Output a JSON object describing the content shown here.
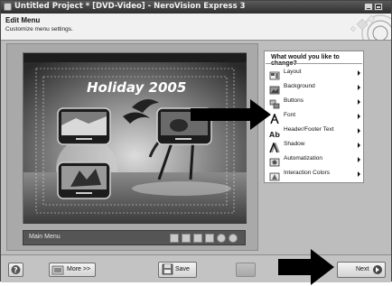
{
  "window": {
    "title": "Untitled Project * [DVD-Video] - NeroVision Express 3",
    "app_icon": "nerovision-app-icon",
    "controls": [
      "minimize-icon",
      "maximize-icon"
    ]
  },
  "header": {
    "title": "Edit Menu",
    "subtitle": "Customize menu settings."
  },
  "preview": {
    "menu_title": "Holiday 2005",
    "thumbnails": 3,
    "menu_bar_label": "Main Menu",
    "menu_bar_icons": [
      "page-icon",
      "page-icon",
      "page-icon",
      "page-icon",
      "circle-check-icon",
      "circle-check-icon"
    ]
  },
  "side_panel": {
    "question": "What would you like to change?",
    "options": [
      {
        "label": "Layout",
        "icon": "layout-icon"
      },
      {
        "label": "Background",
        "icon": "background-icon"
      },
      {
        "label": "Buttons",
        "icon": "buttons-icon"
      },
      {
        "label": "Font",
        "icon": "font-icon"
      },
      {
        "label": "Header/Footer Text",
        "icon": "header-footer-icon"
      },
      {
        "label": "Shadow",
        "icon": "shadow-icon"
      },
      {
        "label": "Automatization",
        "icon": "automatization-icon"
      },
      {
        "label": "Interaction Colors",
        "icon": "interaction-colors-icon"
      }
    ]
  },
  "bottom": {
    "help_icon": "help-icon",
    "more_label": "More >>",
    "save_label": "Save",
    "next_label": "Next"
  },
  "colors": {
    "title_bar": "#3c3c3c",
    "panel_bg": "#bdbdbd",
    "arrow": "#000000"
  }
}
